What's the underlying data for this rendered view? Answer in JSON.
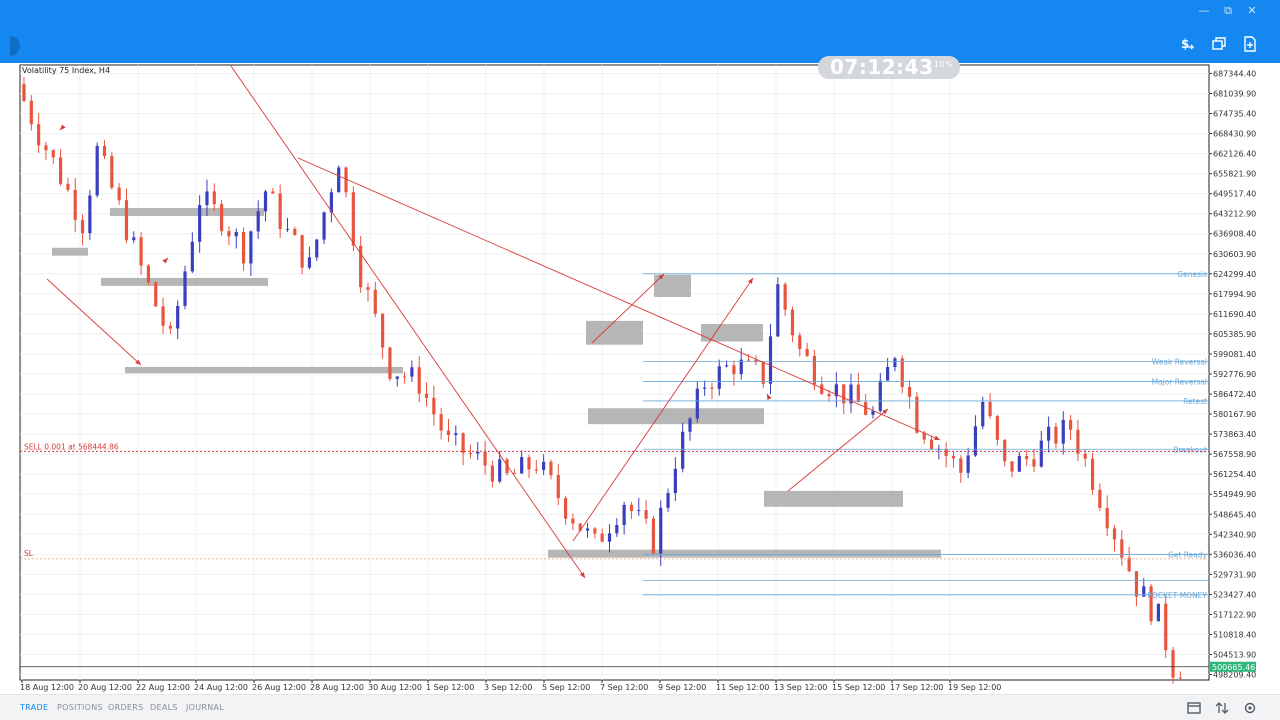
{
  "window": {
    "minimize": "—",
    "restore": "⧉",
    "close": "✕"
  },
  "toolbar": {
    "trade_icon": "dollar-transfer-icon",
    "windows_icon": "windows-icon",
    "new_order_icon": "new-order-icon"
  },
  "chart": {
    "symbol_label": "Volatility 75 Index, H4",
    "clock": "07:12:43",
    "clock_pct": "10%",
    "current_price": "500665.46",
    "order_line_label": "SELL 0.001 at 568444.86",
    "sl_label": "SL",
    "colors": {
      "bull": "#3a3fbf",
      "bear": "#e8553f",
      "zone": "#a9a9a9",
      "level": "#6aa8d8",
      "arrow": "#d83a3a",
      "accent": "#1488f0"
    }
  },
  "chart_data": {
    "type": "candlestick",
    "title": "Volatility 75 Index, H4",
    "y_ticks": [
      "687344.40",
      "681039.90",
      "674735.40",
      "668430.90",
      "662126.40",
      "655821.90",
      "649517.40",
      "643212.90",
      "636908.40",
      "630603.90",
      "624299.40",
      "617994.90",
      "611690.40",
      "605385.90",
      "599081.40",
      "592776.90",
      "586472.40",
      "580167.90",
      "573863.40",
      "567558.90",
      "561254.40",
      "554949.90",
      "548645.40",
      "542340.90",
      "536036.40",
      "529731.90",
      "523427.40",
      "517122.90",
      "510818.40",
      "504513.90",
      "498209.40"
    ],
    "x_ticks": [
      "18 Aug 12:00",
      "20 Aug 12:00",
      "22 Aug 12:00",
      "24 Aug 12:00",
      "26 Aug 12:00",
      "28 Aug 12:00",
      "30 Aug 12:00",
      "1 Sep 12:00",
      "3 Sep 12:00",
      "5 Sep 12:00",
      "7 Sep 12:00",
      "9 Sep 12:00",
      "11 Sep 12:00",
      "13 Sep 12:00",
      "15 Sep 12:00",
      "17 Sep 12:00",
      "19 Sep 12:00"
    ],
    "ylim": [
      496500,
      690000
    ],
    "price_path": [
      [
        0,
        684000
      ],
      [
        3,
        668500
      ],
      [
        6,
        655000
      ],
      [
        9,
        640500
      ],
      [
        11,
        663000
      ],
      [
        14,
        645000
      ],
      [
        17,
        626000
      ],
      [
        21,
        603000
      ],
      [
        25,
        648000
      ],
      [
        28,
        642000
      ],
      [
        31,
        632000
      ],
      [
        34,
        650500
      ],
      [
        37,
        637000
      ],
      [
        40,
        626500
      ],
      [
        44,
        661000
      ],
      [
        47,
        624500
      ],
      [
        51,
        595000
      ],
      [
        55,
        590000
      ],
      [
        59,
        571000
      ],
      [
        63,
        566000
      ],
      [
        67,
        560000
      ],
      [
        71,
        565000
      ],
      [
        75,
        551000
      ],
      [
        79,
        539000
      ],
      [
        83,
        553000
      ],
      [
        87,
        540000
      ],
      [
        90,
        566000
      ],
      [
        94,
        590000
      ],
      [
        98,
        596000
      ],
      [
        102,
        592000
      ],
      [
        104,
        620000
      ],
      [
        107,
        600000
      ],
      [
        110,
        591000
      ],
      [
        114,
        585000
      ],
      [
        117,
        580000
      ],
      [
        120,
        600000
      ],
      [
        123,
        578000
      ],
      [
        126,
        570000
      ],
      [
        129,
        562000
      ],
      [
        132,
        584000
      ],
      [
        135,
        563000
      ],
      [
        138,
        566000
      ],
      [
        141,
        572000
      ],
      [
        144,
        576000
      ],
      [
        147,
        560000
      ],
      [
        150,
        543000
      ],
      [
        153,
        526000
      ],
      [
        156,
        516000
      ],
      [
        158,
        500665
      ]
    ],
    "levels": [
      {
        "label": "Genesis",
        "price": 624300
      },
      {
        "label": "Weak Reversal",
        "price": 596700
      },
      {
        "label": "Major Reversal",
        "price": 590400
      },
      {
        "label": "Retest",
        "price": 584300
      },
      {
        "label": "Breakout",
        "price": 569100
      },
      {
        "label": "Get Ready",
        "price": 536000
      },
      {
        "label": "",
        "price": 527800
      },
      {
        "label": "POCKET MONEY",
        "price": 523300
      }
    ],
    "order_price": 568444.86,
    "sl_price": 534600,
    "current_price": 500665.46
  },
  "bottom": {
    "tabs": [
      "TRADE",
      "POSITIONS",
      "ORDERS",
      "DEALS",
      "JOURNAL"
    ],
    "icons": [
      "wallet-icon",
      "sort-icon",
      "settings-icon"
    ]
  }
}
